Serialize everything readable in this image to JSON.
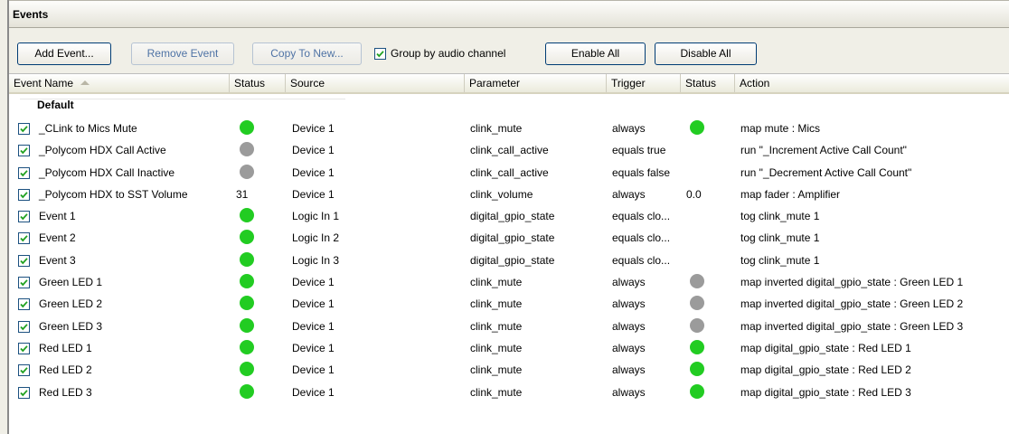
{
  "window": {
    "title": "Events"
  },
  "toolbar": {
    "add_event": "Add Event...",
    "remove_event": "Remove Event",
    "copy_to_new": "Copy To New...",
    "group_by_label": "Group by audio channel",
    "group_by_checked": true,
    "enable_all": "Enable All",
    "disable_all": "Disable All"
  },
  "columns": [
    "Event Name",
    "Status",
    "Source",
    "Parameter",
    "Trigger",
    "Status",
    "Action"
  ],
  "sort": {
    "column": "Event Name",
    "direction": "ascending"
  },
  "group": {
    "name": "Default"
  },
  "colors": {
    "green": "#22cc22",
    "gray": "#9b9b9b"
  },
  "rows": [
    {
      "checked": true,
      "name": "_CLink to Mics Mute",
      "status": "green",
      "source": "Device 1",
      "parameter": "clink_mute",
      "trigger": "always",
      "trigger_status": "green",
      "action": "map mute : Mics"
    },
    {
      "checked": true,
      "name": "_Polycom HDX Call Active",
      "status": "gray",
      "source": "Device 1",
      "parameter": "clink_call_active",
      "trigger": "equals true",
      "trigger_status": "",
      "action": "run \"_Increment Active Call Count\""
    },
    {
      "checked": true,
      "name": "_Polycom HDX Call Inactive",
      "status": "gray",
      "source": "Device 1",
      "parameter": "clink_call_active",
      "trigger": "equals false",
      "trigger_status": "",
      "action": "run \"_Decrement Active Call Count\""
    },
    {
      "checked": true,
      "name": "_Polycom HDX to SST Volume",
      "status": "31",
      "source": "Device 1",
      "parameter": "clink_volume",
      "trigger": "always",
      "trigger_status": "0.0",
      "action": "map fader : Amplifier"
    },
    {
      "checked": true,
      "name": "Event 1",
      "status": "green",
      "source": "Logic In 1",
      "parameter": "digital_gpio_state",
      "trigger": "equals clo...",
      "trigger_status": "",
      "action": "tog clink_mute 1"
    },
    {
      "checked": true,
      "name": "Event 2",
      "status": "green",
      "source": "Logic In 2",
      "parameter": "digital_gpio_state",
      "trigger": "equals clo...",
      "trigger_status": "",
      "action": "tog clink_mute 1"
    },
    {
      "checked": true,
      "name": "Event 3",
      "status": "green",
      "source": "Logic In 3",
      "parameter": "digital_gpio_state",
      "trigger": "equals clo...",
      "trigger_status": "",
      "action": "tog clink_mute 1"
    },
    {
      "checked": true,
      "name": "Green LED 1",
      "status": "green",
      "source": "Device 1",
      "parameter": "clink_mute",
      "trigger": "always",
      "trigger_status": "gray",
      "action": "map inverted digital_gpio_state : Green LED 1"
    },
    {
      "checked": true,
      "name": "Green LED 2",
      "status": "green",
      "source": "Device 1",
      "parameter": "clink_mute",
      "trigger": "always",
      "trigger_status": "gray",
      "action": "map inverted digital_gpio_state : Green LED 2"
    },
    {
      "checked": true,
      "name": "Green LED 3",
      "status": "green",
      "source": "Device 1",
      "parameter": "clink_mute",
      "trigger": "always",
      "trigger_status": "gray",
      "action": "map inverted digital_gpio_state : Green LED 3"
    },
    {
      "checked": true,
      "name": "Red LED 1",
      "status": "green",
      "source": "Device 1",
      "parameter": "clink_mute",
      "trigger": "always",
      "trigger_status": "green",
      "action": "map digital_gpio_state : Red LED 1"
    },
    {
      "checked": true,
      "name": "Red LED 2",
      "status": "green",
      "source": "Device 1",
      "parameter": "clink_mute",
      "trigger": "always",
      "trigger_status": "green",
      "action": "map digital_gpio_state : Red LED 2"
    },
    {
      "checked": true,
      "name": "Red LED 3",
      "status": "green",
      "source": "Device 1",
      "parameter": "clink_mute",
      "trigger": "always",
      "trigger_status": "green",
      "action": "map digital_gpio_state : Red LED 3"
    }
  ]
}
